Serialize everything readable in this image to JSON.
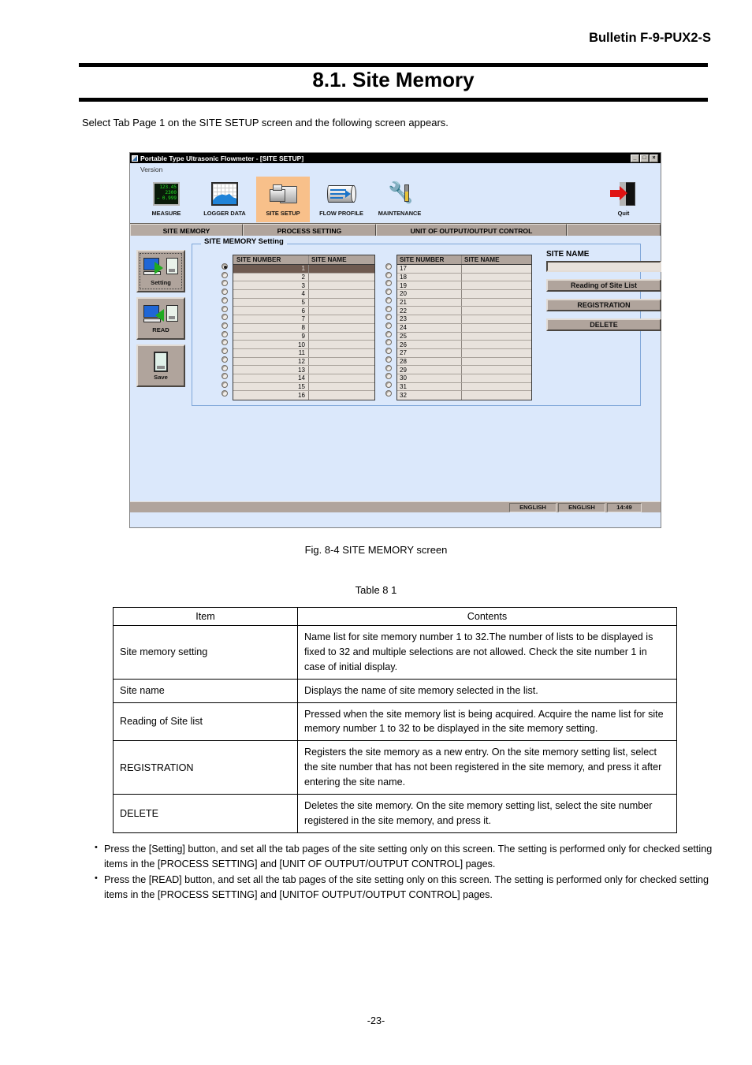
{
  "document": {
    "bulletin": "Bulletin F-9-PUX2-S",
    "chapter_title": "8.1. Site Memory",
    "intro": "Select Tab Page 1 on the SITE SETUP screen and the following screen appears.",
    "figure_caption": "Fig. 8-4 SITE MEMORY screen",
    "table_caption": "Table 8   1",
    "page_number": "-23-"
  },
  "screenshot": {
    "titlebar": {
      "title": "Portable Type Ultrasonic Flowmeter - [SITE SETUP]",
      "minimize": "_",
      "maximize": "□",
      "close": "×"
    },
    "menubar": {
      "version": "Version"
    },
    "toolbar": {
      "items": [
        {
          "label": "MEASURE",
          "icon": "lcd-display-icon",
          "active": false
        },
        {
          "label": "LOGGER DATA",
          "icon": "chart-graph-icon",
          "active": false
        },
        {
          "label": "SITE SETUP",
          "icon": "folder-disk-icon",
          "active": true
        },
        {
          "label": "FLOW PROFILE",
          "icon": "pipe-flow-icon",
          "active": false
        },
        {
          "label": "MAINTENANCE",
          "icon": "wrench-screwdriver-icon",
          "active": false
        }
      ],
      "quit": {
        "label": "Quit",
        "icon": "exit-door-arrow-icon"
      },
      "lcd": {
        "line1": "123.45",
        "line2": "2300",
        "line3": "− 0.999"
      }
    },
    "tabs": [
      {
        "label": "SITE MEMORY",
        "selected": true
      },
      {
        "label": "PROCESS SETTING",
        "selected": false
      },
      {
        "label": "UNIT OF OUTPUT/OUTPUT CONTROL",
        "selected": false
      },
      {
        "label": "",
        "selected": false
      }
    ],
    "side_buttons": [
      {
        "label": "Setting",
        "icon": "pc-to-device-icon",
        "focused": true
      },
      {
        "label": "READ",
        "icon": "device-to-pc-icon",
        "focused": false
      },
      {
        "label": "Save",
        "icon": "save-device-icon",
        "focused": false
      }
    ],
    "group": {
      "label": "SITE MEMORY Setting",
      "columns": {
        "number": "SITE NUMBER",
        "name": "SITE NAME"
      },
      "left_rows": [
        {
          "number": "1",
          "name": "",
          "selected": true
        },
        {
          "number": "2",
          "name": "",
          "selected": false
        },
        {
          "number": "3",
          "name": "",
          "selected": false
        },
        {
          "number": "4",
          "name": "",
          "selected": false
        },
        {
          "number": "5",
          "name": "",
          "selected": false
        },
        {
          "number": "6",
          "name": "",
          "selected": false
        },
        {
          "number": "7",
          "name": "",
          "selected": false
        },
        {
          "number": "8",
          "name": "",
          "selected": false
        },
        {
          "number": "9",
          "name": "",
          "selected": false
        },
        {
          "number": "10",
          "name": "",
          "selected": false
        },
        {
          "number": "11",
          "name": "",
          "selected": false
        },
        {
          "number": "12",
          "name": "",
          "selected": false
        },
        {
          "number": "13",
          "name": "",
          "selected": false
        },
        {
          "number": "14",
          "name": "",
          "selected": false
        },
        {
          "number": "15",
          "name": "",
          "selected": false
        },
        {
          "number": "16",
          "name": "",
          "selected": false
        }
      ],
      "right_rows": [
        {
          "number": "17",
          "name": "",
          "selected": false
        },
        {
          "number": "18",
          "name": "",
          "selected": false
        },
        {
          "number": "19",
          "name": "",
          "selected": false
        },
        {
          "number": "20",
          "name": "",
          "selected": false
        },
        {
          "number": "21",
          "name": "",
          "selected": false
        },
        {
          "number": "22",
          "name": "",
          "selected": false
        },
        {
          "number": "23",
          "name": "",
          "selected": false
        },
        {
          "number": "24",
          "name": "",
          "selected": false
        },
        {
          "number": "25",
          "name": "",
          "selected": false
        },
        {
          "number": "26",
          "name": "",
          "selected": false
        },
        {
          "number": "27",
          "name": "",
          "selected": false
        },
        {
          "number": "28",
          "name": "",
          "selected": false
        },
        {
          "number": "29",
          "name": "",
          "selected": false
        },
        {
          "number": "30",
          "name": "",
          "selected": false
        },
        {
          "number": "31",
          "name": "",
          "selected": false
        },
        {
          "number": "32",
          "name": "",
          "selected": false
        }
      ]
    },
    "right_panel": {
      "site_name_label": "SITE NAME",
      "site_name_value": "",
      "buttons": [
        {
          "label": "Reading of Site List"
        },
        {
          "label": "REGISTRATION"
        },
        {
          "label": "DELETE"
        }
      ]
    },
    "statusbar": {
      "panel1": "ENGLISH",
      "panel2": "ENGLISH",
      "time": "14:49"
    },
    "colors": {
      "window_bg": "#dbe8fb",
      "control_face": "#b0a49c",
      "active_tool": "#f8c08a",
      "selected_row": "#6e5a50",
      "list_bg": "#e8e2dc"
    }
  },
  "table": {
    "headers": [
      "Item",
      "Contents"
    ],
    "rows": [
      {
        "item": "Site memory setting",
        "contents": "Name list for site memory number 1 to 32.The number of lists to be displayed is fixed to 32 and multiple selections are not allowed. Check the site number 1 in case of initial display."
      },
      {
        "item": "Site name",
        "contents": "Displays the name of site memory selected in the list."
      },
      {
        "item": "Reading of Site list",
        "contents": "Pressed when the site memory list is being acquired. Acquire the name list for site memory number 1 to 32 to be displayed in the site memory setting."
      },
      {
        "item": "REGISTRATION",
        "contents": "Registers the site memory as a new entry. On the site memory setting list, select the site number that has not been registered in the site memory, and press it after entering the site name."
      },
      {
        "item": "DELETE",
        "contents": "Deletes the site memory. On the site memory setting list, select the site number registered in the site memory, and press it."
      }
    ]
  },
  "notes": [
    "Press the [Setting] button, and set all the tab pages of the site setting only on this screen. The setting is performed only for checked setting items in the [PROCESS SETTING] and [UNIT OF OUTPUT/OUTPUT CONTROL] pages.",
    "Press the [READ] button, and set all the tab pages of the site setting only on this screen. The setting is performed only for checked setting items in the [PROCESS SETTING] and [UNITOF OUTPUT/OUTPUT CONTROL] pages."
  ]
}
